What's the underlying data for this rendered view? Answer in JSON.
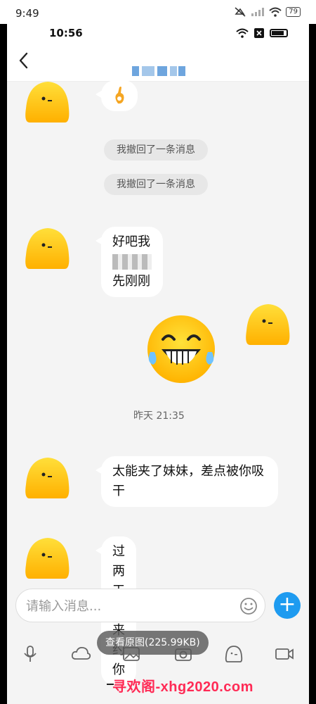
{
  "outer_status": {
    "time": "9:49",
    "battery": "79"
  },
  "inner_status": {
    "time": "10:56"
  },
  "header": {
    "title_obscured": true
  },
  "messages": {
    "sys1": "我撤回了一条消息",
    "sys2": "我撤回了一条消息",
    "m1_part1": "好吧我",
    "m1_part2": "先刚刚",
    "timestamp": "昨天 21:35",
    "m2": "太能夹了妹妹，差点被你吸干",
    "m3": "过两天再来约你"
  },
  "input": {
    "placeholder": "请输入消息..."
  },
  "toast": {
    "text": "查看原图(225.99KB)"
  },
  "watermark": {
    "text": "寻欢阁-xhg2020.com"
  },
  "colors": {
    "accent": "#1e9bf0",
    "bubble": "#ffffff",
    "background": "#f4f4f4",
    "avatar": "#ffc21a",
    "watermark": "#ff2a55"
  },
  "toolbar": {
    "icons": [
      "mic-icon",
      "cloud-icon",
      "image-icon",
      "camera-icon",
      "emoji-icon",
      "gif-icon"
    ]
  }
}
